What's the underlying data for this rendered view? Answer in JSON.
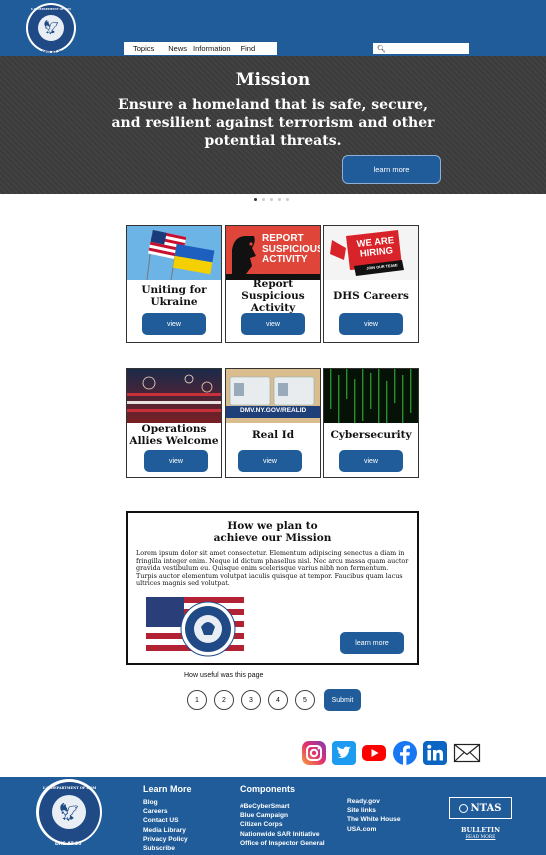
{
  "header": {
    "seal_text": "U.S. DEPARTMENT OF HOMELAND SECURITY",
    "seal_badge": "DHS AT 20",
    "nav_items": [
      "Topics",
      "News",
      "Information",
      "Find"
    ],
    "search": {
      "placeholder": "",
      "icon": "search-icon"
    }
  },
  "hero": {
    "title": "Mission",
    "text": "Ensure a homeland that is safe, secure, and resilient against terrorism and other potential threats.",
    "button_label": "learn more",
    "carousel_dots": 5,
    "active_dot": 1
  },
  "cards": [
    {
      "title": "Uniting for Ukraine",
      "button_label": "view",
      "image": "us-ukraine-flags"
    },
    {
      "title": "Report Suspicious Activity",
      "button_label": "view",
      "image": "report-suspicious-activity-graphic",
      "image_text": "REPORT SUSPICIOUS ACTIVITY"
    },
    {
      "title": "DHS Careers",
      "button_label": "view",
      "image": "we-are-hiring-graphic",
      "image_text": "WE ARE HIRING",
      "image_subtext": "JOIN OUR TEAM!"
    },
    {
      "title": "Operations Allies Welcome",
      "button_label": "view",
      "image": "us-flag-fireworks"
    },
    {
      "title": "Real Id",
      "button_label": "view",
      "image": "real-id-cards",
      "image_text": "DMV.NY.GOV/REALID"
    },
    {
      "title": "Cybersecurity",
      "button_label": "view",
      "image": "matrix-code"
    }
  ],
  "plan": {
    "title": "How we plan to achieve our Mission",
    "body": "Lorem ipsum dolor sit amet consectetur. Elementum adipiscing senectus a diam in fringilla integer enim. Neque id dictum phasellus nisl. Nec arcu massa quam auctor gravida vestibulum eu. Quisque enim scelerisque varius nibh non fermentum. Turpis auctor elementum volutpat iaculis quisque at tempor. Faucibus quam lacus ultrices magnis sed volutpat.",
    "button_label": "learn more",
    "image": "dhs-seal-on-flag"
  },
  "rating": {
    "question": "How useful was this page",
    "options": [
      "1",
      "2",
      "3",
      "4",
      "5"
    ],
    "submit_label": "Submit"
  },
  "social": [
    "instagram-icon",
    "twitter-icon",
    "youtube-icon",
    "facebook-icon",
    "linkedin-icon",
    "email-icon"
  ],
  "footer": {
    "learn_more_heading": "Learn More",
    "learn_more_links": [
      "Blog",
      "Careers",
      "Contact US",
      "Media Library",
      "Privacy Policy",
      "Subscribe"
    ],
    "components_heading": "Components",
    "components_links": [
      "#BeCyberSmart",
      "Blue Campaign",
      "Citizen Corps",
      "Nationwide SAR Initiative",
      "Office of Inspector General"
    ],
    "other_links": [
      "Ready.gov",
      "Site links",
      "The White House",
      "USA.com"
    ],
    "ntas": {
      "logo": "NTAS",
      "bulletin": "BULLETIN",
      "read_more": "READ MORE"
    }
  },
  "colors": {
    "brand_blue": "#1f5c99",
    "hero_bg": "#3d3d3d",
    "white": "#ffffff"
  }
}
